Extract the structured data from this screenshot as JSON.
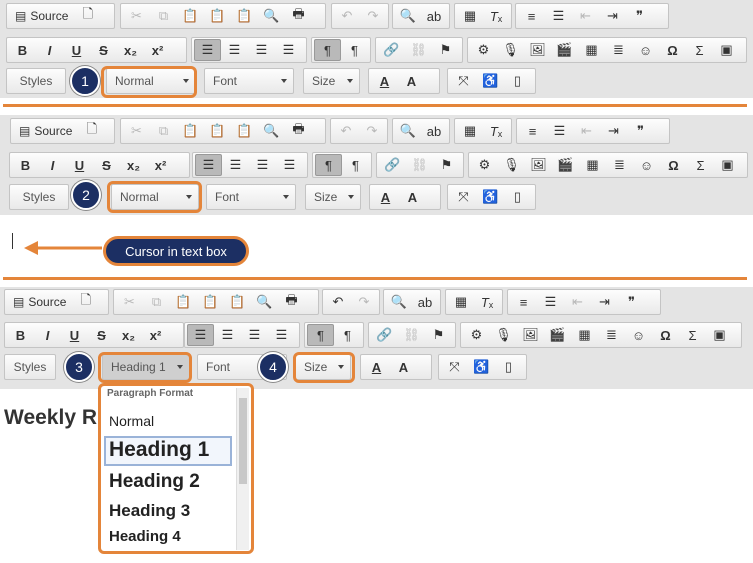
{
  "toolbar": {
    "source_label": "Source",
    "styles_label": "Styles",
    "format_label_1": "Normal",
    "format_label_2": "Normal",
    "format_label_3": "Heading 1",
    "font_label": "Font",
    "size_label": "Size",
    "bold": "B",
    "italic": "I",
    "underline": "U",
    "strike": "S",
    "subscript": "x₂",
    "superscript": "x²",
    "quote": "❞",
    "omega": "Ω",
    "sigma": "Σ",
    "text_color": "A",
    "bg_color": "A"
  },
  "badges": {
    "b1": "1",
    "b2": "2",
    "b3": "3",
    "b4": "4"
  },
  "callout": {
    "text": "Cursor in text box"
  },
  "dropdown": {
    "header": "Paragraph Format",
    "items": [
      "Normal",
      "Heading 1",
      "Heading 2",
      "Heading 3",
      "Heading 4"
    ]
  },
  "page": {
    "heading_partial": "Weekly R"
  },
  "colors": {
    "accent_orange": "#e4853a",
    "badge_navy": "#1c2f63",
    "toolbar_bg": "#e4e4e4"
  }
}
